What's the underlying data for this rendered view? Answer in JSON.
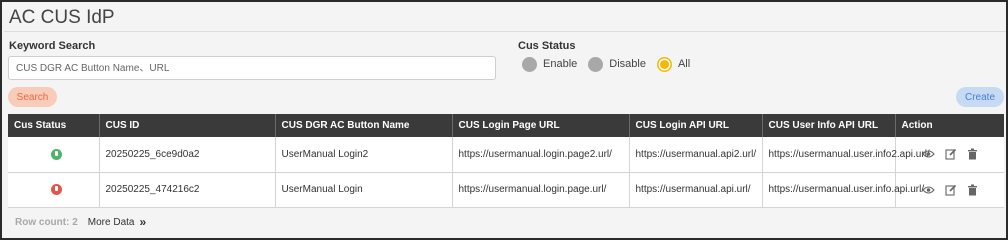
{
  "page": {
    "title": "AC CUS IdP"
  },
  "search": {
    "keyword_label": "Keyword Search",
    "placeholder": "CUS DGR AC Button Name、URL",
    "value": "",
    "button_label": "Search"
  },
  "status_filter": {
    "label": "Cus Status",
    "options": [
      {
        "label": "Enable",
        "selected": false
      },
      {
        "label": "Disable",
        "selected": false
      },
      {
        "label": "All",
        "selected": true
      }
    ],
    "selected_color": "#f5b800"
  },
  "create_label": "Create",
  "table": {
    "headers": [
      "Cus Status",
      "CUS ID",
      "CUS DGR AC Button Name",
      "CUS Login Page URL",
      "CUS Login API URL",
      "CUS User Info API URL",
      "Action"
    ],
    "rows": [
      {
        "status": "enabled",
        "cus_id": "20250225_6ce9d0a2",
        "button_name": "UserManual Login2",
        "login_page_url": "https://usermanual.login.page2.url/",
        "login_api_url": "https://usermanual.api2.url/",
        "user_info_api_url": "https://usermanual.user.info2.api.url/"
      },
      {
        "status": "disabled",
        "cus_id": "20250225_474216c2",
        "button_name": "UserManual Login",
        "login_page_url": "https://usermanual.login.page.url/",
        "login_api_url": "https://usermanual.api.url/",
        "user_info_api_url": "https://usermanual.user.info.api.url/"
      }
    ],
    "action_icons": [
      "eye-icon",
      "edit-icon",
      "trash-icon"
    ]
  },
  "footer": {
    "row_count_label": "Row count: 2",
    "more_data_label": "More Data",
    "more_data_icon": "double-chevron-right-icon"
  },
  "colors": {
    "header_bg": "#3a3a3a",
    "search_button_bg": "#f9cbb9",
    "search_button_text": "#e86a44",
    "create_button_bg": "#c6daf4",
    "create_button_text": "#4a7fcd",
    "status_enabled": "#4fb36a",
    "status_disabled": "#e0564a"
  }
}
